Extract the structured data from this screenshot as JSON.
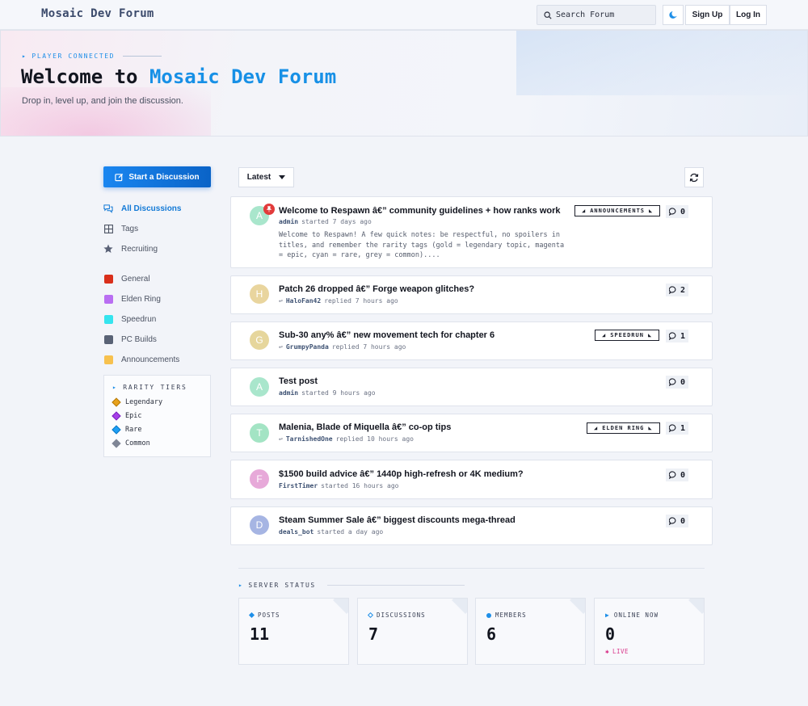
{
  "header": {
    "brand": "Mosaic Dev Forum",
    "search_label": "Search Forum",
    "theme_icon": "moon-icon",
    "signup_label": "Sign Up",
    "login_label": "Log In"
  },
  "hero": {
    "eyebrow": "PLAYER CONNECTED",
    "title_prefix": "Welcome to",
    "title_accent": "Mosaic Dev Forum",
    "subtitle": "Drop in, level up, and join the discussion."
  },
  "sidebar": {
    "start_label": "Start a Discussion",
    "nav": [
      {
        "label": "All Discussions",
        "icon": "chat-bubbles-icon"
      },
      {
        "label": "Tags",
        "icon": "grid-icon"
      },
      {
        "label": "Recruiting",
        "icon": "star-icon"
      }
    ],
    "tags": [
      {
        "label": "General",
        "color": "#d92f1b"
      },
      {
        "label": "Elden Ring",
        "color": "#b96ef2"
      },
      {
        "label": "Speedrun",
        "color": "#35e4ee"
      },
      {
        "label": "PC Builds",
        "color": "#596275"
      },
      {
        "label": "Announcements",
        "color": "#f7c14e"
      }
    ],
    "rarity": {
      "title": "RARITY TIERS",
      "items": [
        {
          "label": "Legendary",
          "color": "#e8a21c"
        },
        {
          "label": "Epic",
          "color": "#a640e8"
        },
        {
          "label": "Rare",
          "color": "#1e9ff5"
        },
        {
          "label": "Common",
          "color": "#7f8696"
        }
      ]
    }
  },
  "main": {
    "sort_label": "Latest",
    "discussions": [
      {
        "avatar": "A",
        "avatar_color": "#a9e6cc",
        "pinned": true,
        "title": "Welcome to Respawn â€” community guidelines + how ranks work",
        "user": "admin",
        "action": "started 7 days ago",
        "reply_icon": false,
        "excerpt": "Welcome to Respawn! A few quick notes: be respectful, no spoilers in titles, and remember the rarity tags (gold = legendary topic, magenta = epic, cyan = rare, grey = common)....",
        "tag": "ANNOUNCEMENTS",
        "replies": "0"
      },
      {
        "avatar": "H",
        "avatar_color": "#e9d59e",
        "pinned": false,
        "title": "Patch 26 dropped â€” Forge weapon glitches?",
        "user": "HaloFan42",
        "action": "replied 7 hours ago",
        "reply_icon": true,
        "excerpt": "",
        "tag": "",
        "replies": "2"
      },
      {
        "avatar": "G",
        "avatar_color": "#e6d69c",
        "pinned": false,
        "title": "Sub-30 any% â€” new movement tech for chapter 6",
        "user": "GrumpyPanda",
        "action": "replied 7 hours ago",
        "reply_icon": true,
        "excerpt": "",
        "tag": "SPEEDRUN",
        "replies": "1"
      },
      {
        "avatar": "A",
        "avatar_color": "#a9e6cc",
        "pinned": false,
        "title": "Test post",
        "user": "admin",
        "action": "started 9 hours ago",
        "reply_icon": false,
        "excerpt": "",
        "tag": "",
        "replies": "0"
      },
      {
        "avatar": "T",
        "avatar_color": "#a3e4c4",
        "pinned": false,
        "title": "Malenia, Blade of Miquella â€” co-op tips",
        "user": "TarnishedOne",
        "action": "replied 10 hours ago",
        "reply_icon": true,
        "excerpt": "",
        "tag": "ELDEN RING",
        "replies": "1"
      },
      {
        "avatar": "F",
        "avatar_color": "#e7a9d9",
        "pinned": false,
        "title": "$1500 build advice â€” 1440p high-refresh or 4K medium?",
        "user": "FirstTimer",
        "action": "started 16 hours ago",
        "reply_icon": false,
        "excerpt": "",
        "tag": "",
        "replies": "0"
      },
      {
        "avatar": "D",
        "avatar_color": "#a6b5e3",
        "pinned": false,
        "title": "Steam Summer Sale â€” biggest discounts mega-thread",
        "user": "deals_bot",
        "action": "started a day ago",
        "reply_icon": false,
        "excerpt": "",
        "tag": "",
        "replies": "0"
      }
    ]
  },
  "server_status": {
    "title": "SERVER STATUS",
    "stats": [
      {
        "label": "POSTS",
        "value": "11",
        "marker": "diamond",
        "color": "#1e8fe8"
      },
      {
        "label": "DISCUSSIONS",
        "value": "7",
        "marker": "diamond-outline",
        "color": "#1e8fe8"
      },
      {
        "label": "MEMBERS",
        "value": "6",
        "marker": "circle",
        "color": "#1e8fe8"
      },
      {
        "label": "ONLINE NOW",
        "value": "0",
        "marker": "triangle",
        "color": "#1e8fe8",
        "live": "LIVE",
        "live_color": "#d9368a"
      }
    ]
  }
}
